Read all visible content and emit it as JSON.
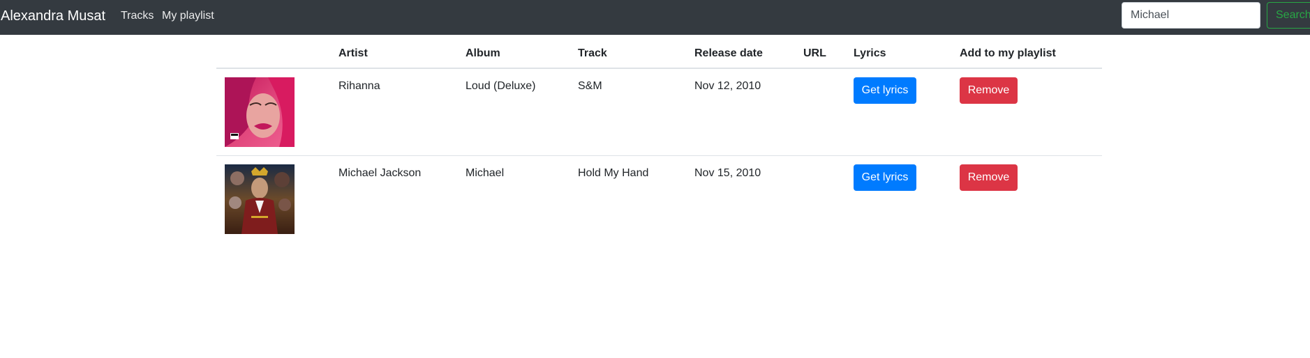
{
  "navbar": {
    "brand": "Alexandra Musat",
    "links": [
      {
        "label": "Tracks"
      },
      {
        "label": "My playlist"
      }
    ],
    "search": {
      "value": "Michael",
      "button_label": "Search"
    }
  },
  "table": {
    "headers": {
      "image": "",
      "artist": "Artist",
      "album": "Album",
      "track": "Track",
      "release_date": "Release date",
      "url": "URL",
      "lyrics": "Lyrics",
      "add": "Add to my playlist"
    },
    "rows": [
      {
        "artist": "Rihanna",
        "album": "Loud (Deluxe)",
        "track": "S&M",
        "release_date": "Nov 12, 2010",
        "url": "",
        "lyrics_button": "Get lyrics",
        "action_button": "Remove"
      },
      {
        "artist": "Michael Jackson",
        "album": "Michael",
        "track": "Hold My Hand",
        "release_date": "Nov 15, 2010",
        "url": "",
        "lyrics_button": "Get lyrics",
        "action_button": "Remove"
      }
    ]
  },
  "colors": {
    "navbar_bg": "#343a40",
    "primary": "#007bff",
    "danger": "#dc3545",
    "success": "#28a745"
  }
}
